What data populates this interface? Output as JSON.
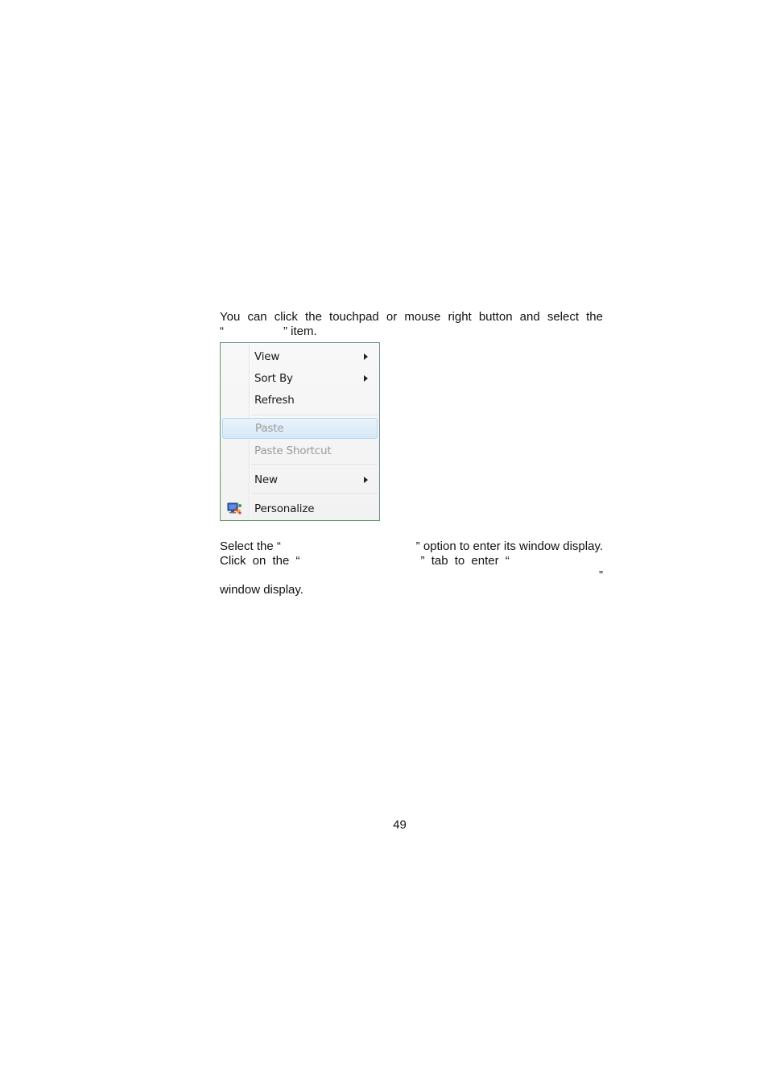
{
  "intro": {
    "line1": "You can click the touchpad or mouse right button and select the",
    "line2_open_quote": "“",
    "line2_close": "” item."
  },
  "context_menu": {
    "items": [
      {
        "label": "View",
        "submenu": true,
        "disabled": false
      },
      {
        "label": "Sort By",
        "submenu": true,
        "disabled": false
      },
      {
        "label": "Refresh",
        "submenu": false,
        "disabled": false
      },
      {
        "label": "Paste",
        "submenu": false,
        "disabled": true
      },
      {
        "label": "Paste Shortcut",
        "submenu": false,
        "disabled": true
      },
      {
        "label": "New",
        "submenu": true,
        "disabled": false
      },
      {
        "label": "Personalize",
        "submenu": false,
        "disabled": false,
        "icon": "personalize-icon"
      }
    ],
    "colors": {
      "hover_bg": "#d7e9f8",
      "hover_border": "#b7d4ec",
      "disabled_text": "#9a9a9a"
    }
  },
  "instructions": {
    "l1_a": "Select the “",
    "l1_b": "” option to enter its window display.",
    "l2_a": "Click on the “",
    "l2_b": "” tab to enter “",
    "l3": "”",
    "l4": "window display."
  },
  "page_number": "49"
}
